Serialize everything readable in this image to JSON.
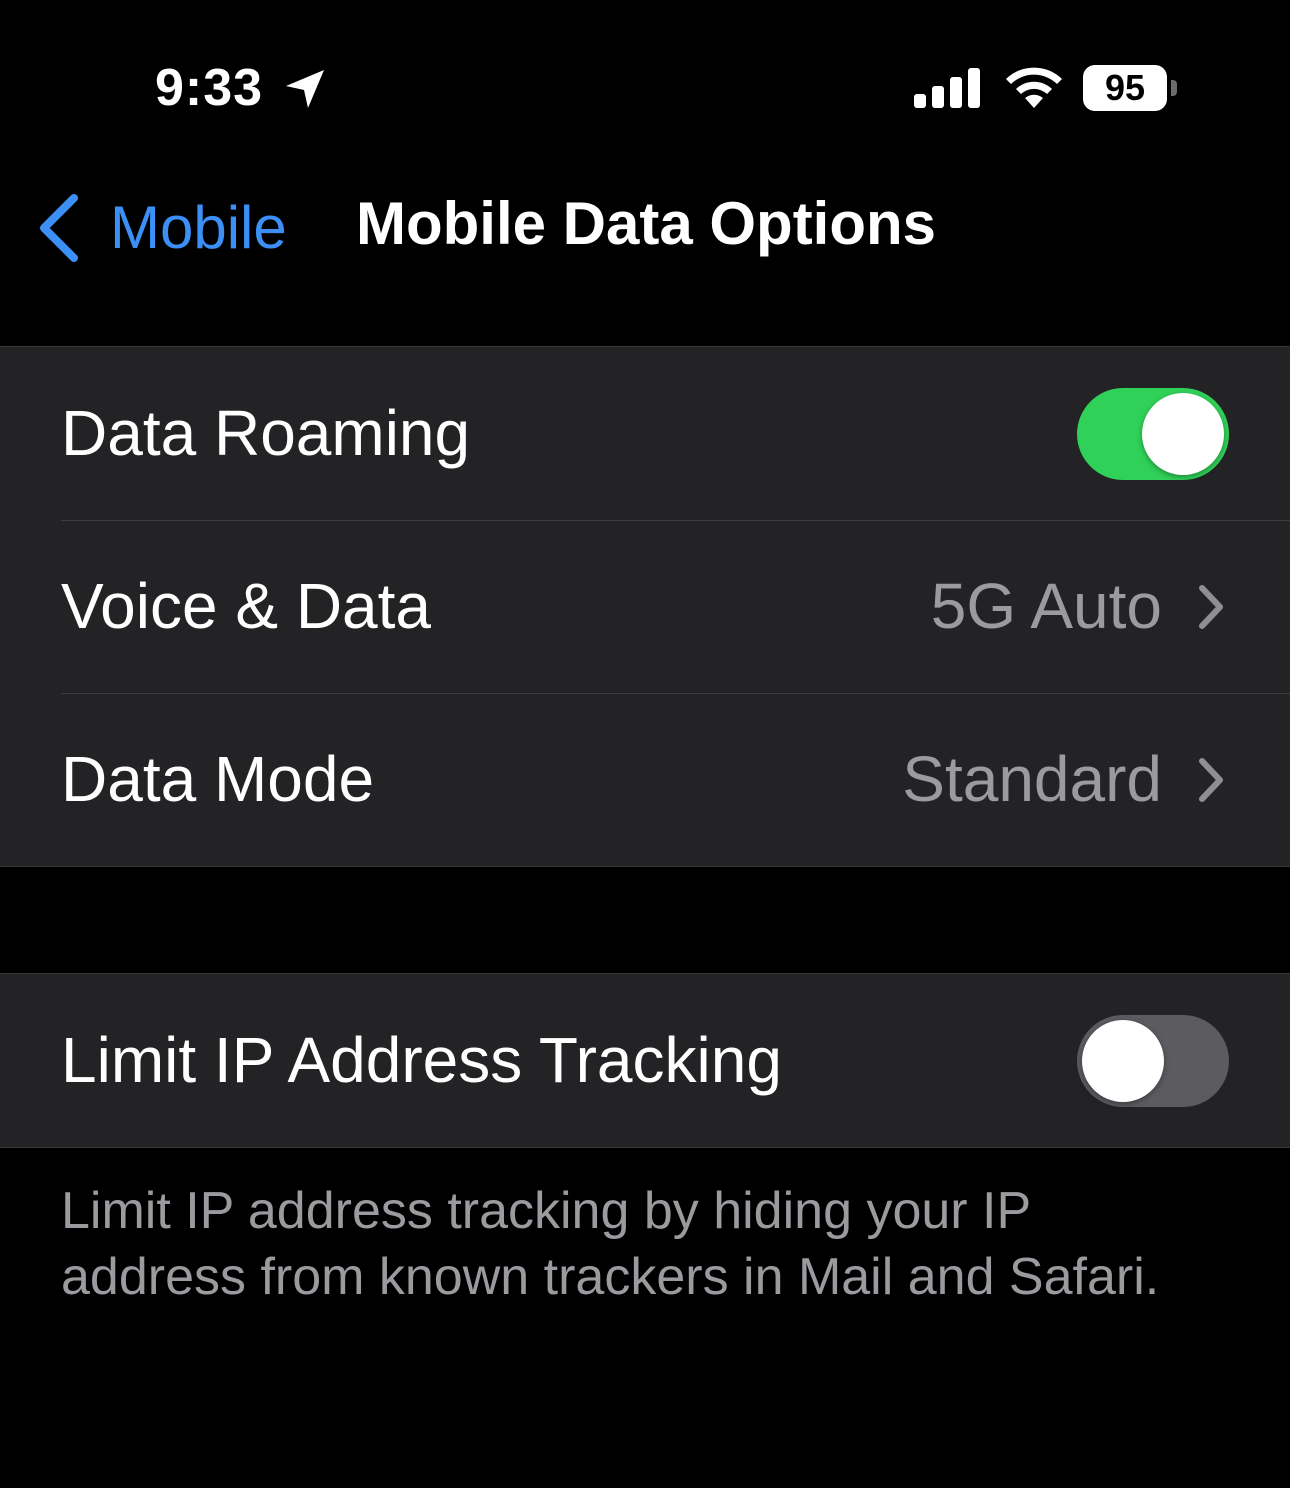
{
  "status_bar": {
    "time": "9:33",
    "battery_level": "95",
    "icons": [
      "location-arrow-icon",
      "cellular-signal-icon",
      "wifi-icon",
      "battery-icon"
    ]
  },
  "nav": {
    "back_label": "Mobile",
    "title": "Mobile Data Options"
  },
  "group1": {
    "data_roaming": {
      "label": "Data Roaming",
      "enabled": true
    },
    "voice_data": {
      "label": "Voice & Data",
      "value": "5G Auto"
    },
    "data_mode": {
      "label": "Data Mode",
      "value": "Standard"
    }
  },
  "group2": {
    "limit_ip": {
      "label": "Limit IP Address Tracking",
      "enabled": false
    },
    "footer": "Limit IP address tracking by hiding your IP address from known trackers in Mail and Safari."
  },
  "colors": {
    "accent_blue": "#3b8ff5",
    "toggle_on": "#30d158",
    "toggle_off": "#5b5b60",
    "cell_background": "#232325",
    "secondary_text": "#9a9a9f"
  }
}
